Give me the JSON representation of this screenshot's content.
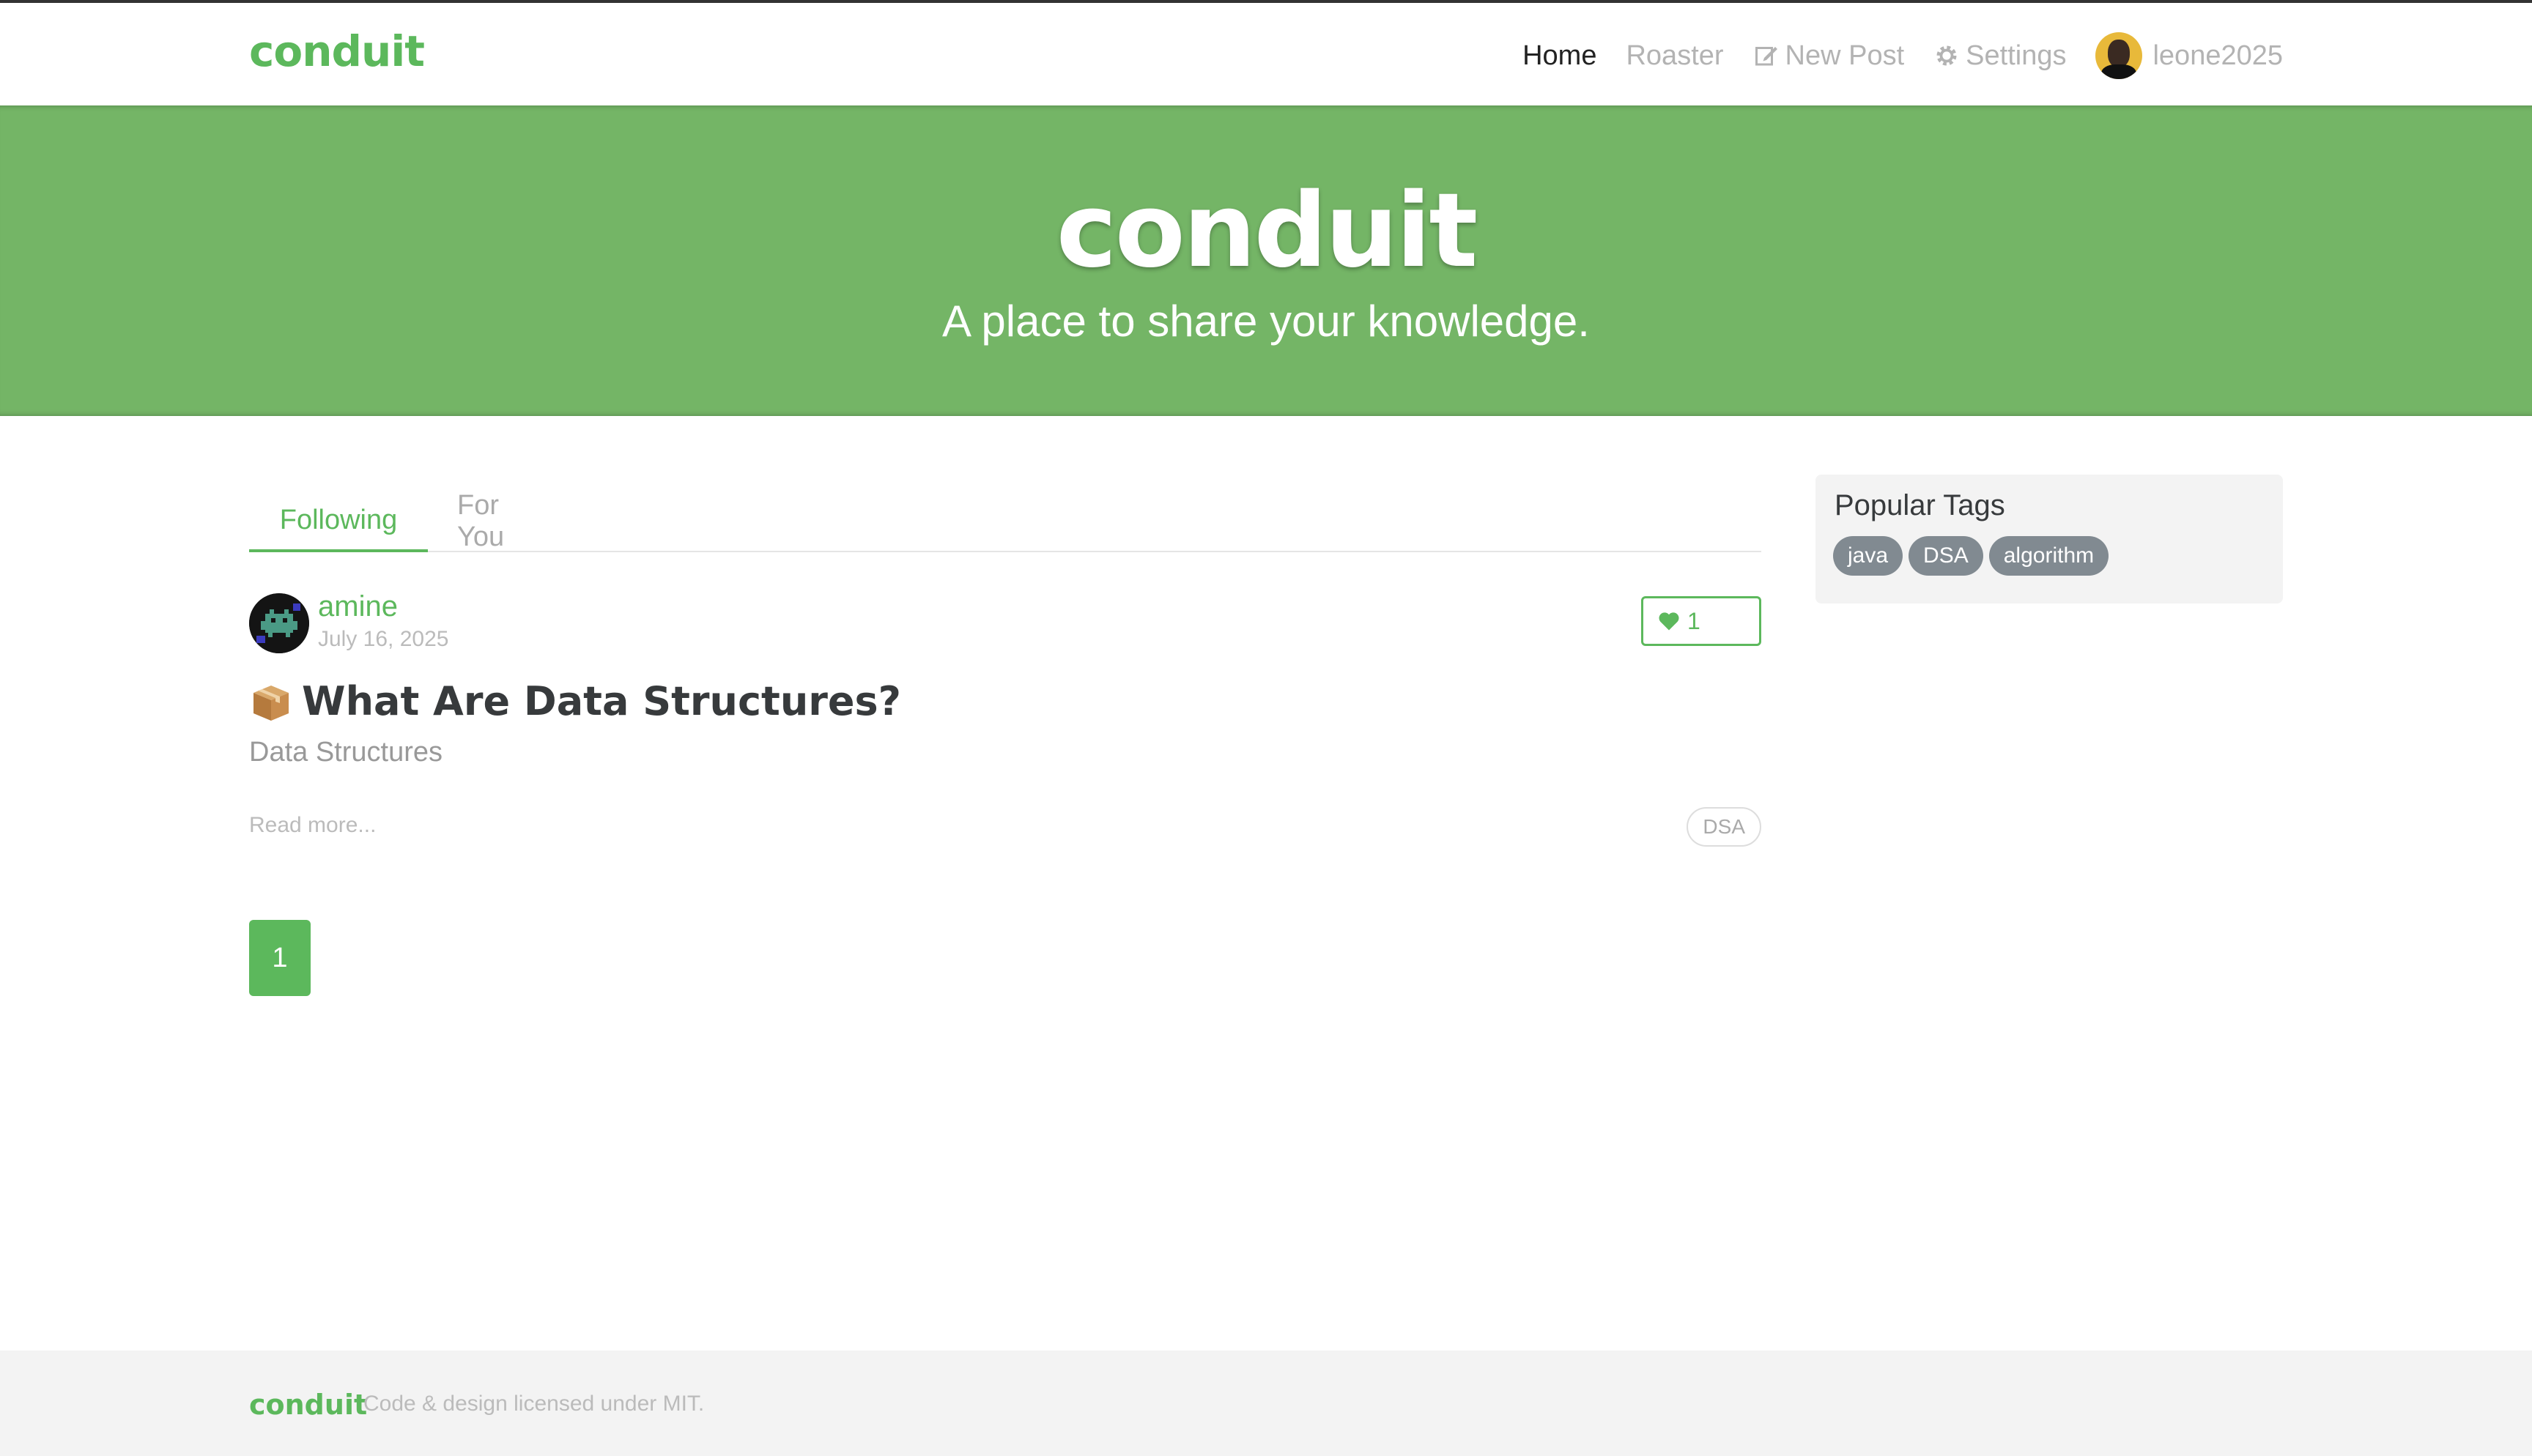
{
  "nav": {
    "brand": "conduit",
    "links": [
      {
        "label": "Home",
        "icon": null,
        "active": true
      },
      {
        "label": "Roaster",
        "icon": null,
        "active": false
      },
      {
        "label": "New Post",
        "icon": "edit-icon",
        "active": false
      },
      {
        "label": "Settings",
        "icon": "gear-icon",
        "active": false
      }
    ],
    "username": "leone2025"
  },
  "banner": {
    "title": "conduit",
    "subtitle": "A place to share your knowledge."
  },
  "feed": {
    "tabs": [
      {
        "label": "Following",
        "active": true
      },
      {
        "label": "For You",
        "active": false
      }
    ],
    "articles": [
      {
        "author": "amine",
        "date": "July 16, 2025",
        "favorites": "1",
        "title": "What Are Data Structures?",
        "title_emoji_icon": "package-icon",
        "description": "Data Structures",
        "read_more": "Read more...",
        "tags": [
          "DSA"
        ]
      }
    ],
    "pagination": {
      "current": "1"
    }
  },
  "sidebar": {
    "title": "Popular Tags",
    "tags": [
      "java",
      "DSA",
      "algorithm"
    ]
  },
  "footer": {
    "brand": "conduit",
    "text": "Code & design licensed under MIT."
  },
  "colors": {
    "accent": "#5cb85c",
    "banner": "#74b566",
    "tag_pill": "#818a91"
  }
}
